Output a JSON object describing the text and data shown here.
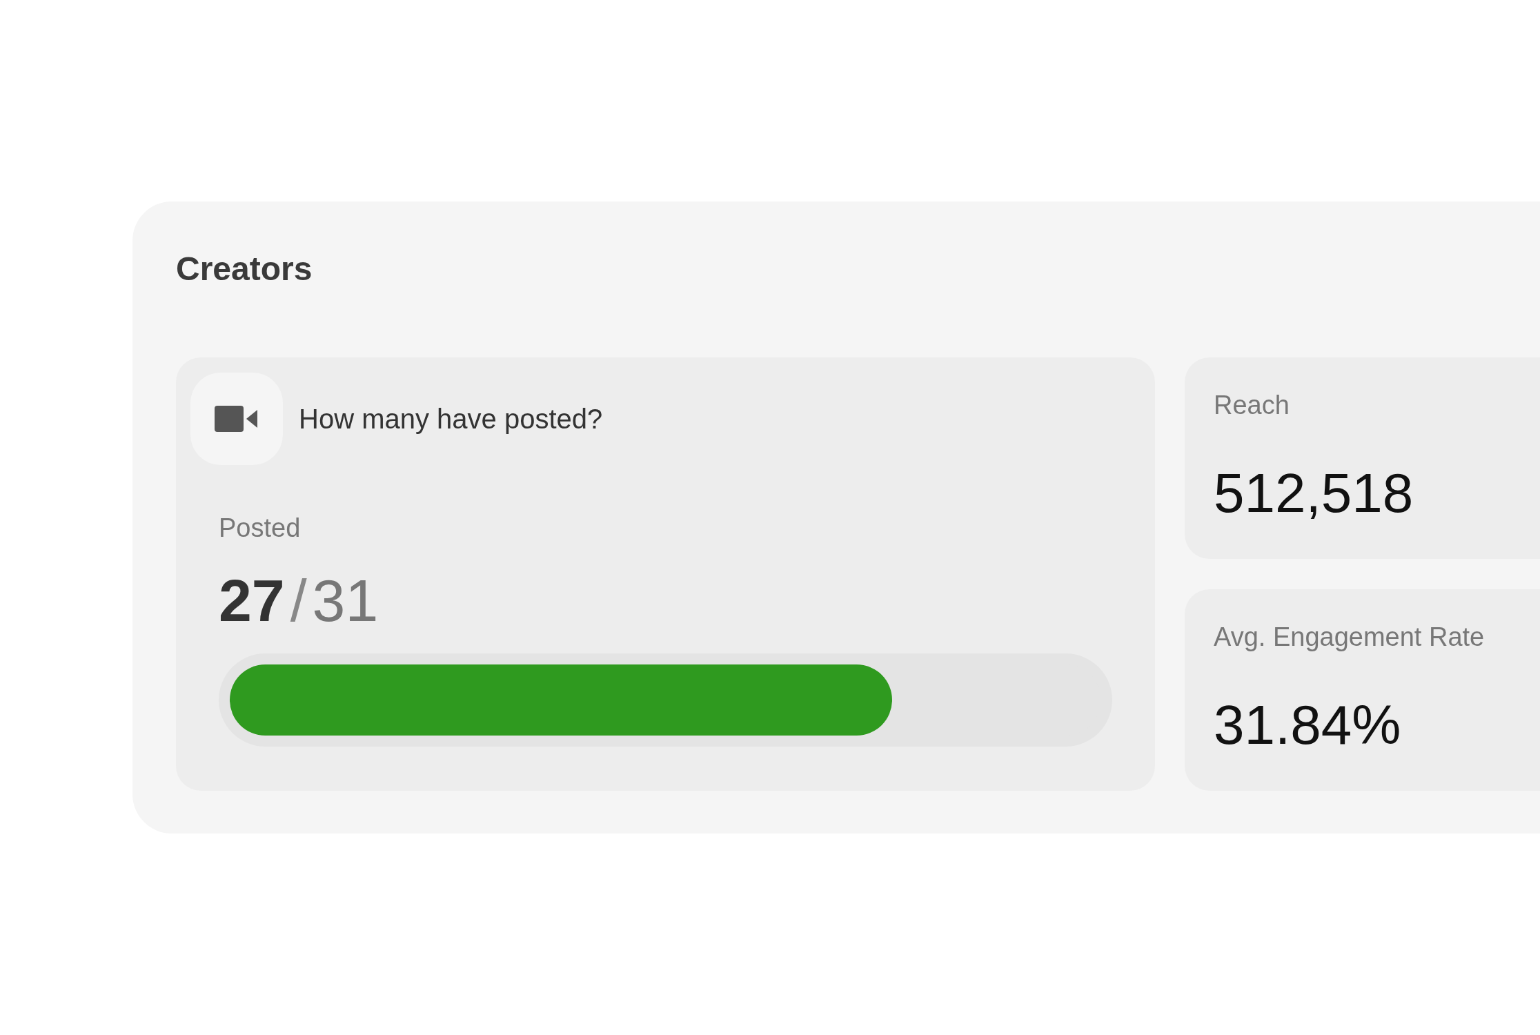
{
  "panel": {
    "title": "Creators"
  },
  "posted_card": {
    "question": "How many have posted?",
    "label": "Posted",
    "count": "27",
    "separator": "/",
    "total": "31",
    "level": 0.76
  },
  "metrics": [
    {
      "label": "Reach",
      "value": "512,518"
    },
    {
      "label": "Avg. Engagement Rate",
      "value": "31.84%"
    }
  ]
}
